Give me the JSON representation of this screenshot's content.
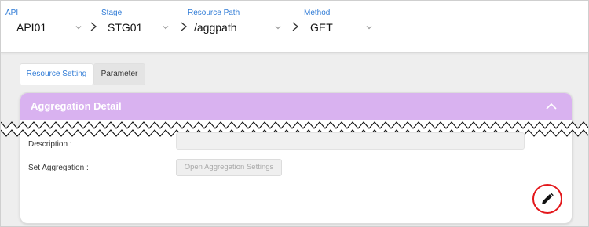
{
  "header": {
    "selectors": [
      {
        "label": "API",
        "value": "API01"
      },
      {
        "label": "Stage",
        "value": "STG01"
      },
      {
        "label": "Resource Path",
        "value": "/aggpath"
      },
      {
        "label": "Method",
        "value": "GET"
      }
    ]
  },
  "tabs": [
    {
      "label": "Resource Setting",
      "active": true
    },
    {
      "label": "Parameter",
      "active": false
    }
  ],
  "panel": {
    "title": "Aggregation Detail",
    "header_color": "#d9b2f0",
    "fields": {
      "description_label": "Description :",
      "description_value": "",
      "set_aggregation_label": "Set Aggregation :",
      "aggregation_button_label": "Open Aggregation Settings"
    }
  },
  "icons": {
    "selector_chevron": "chevron-down-icon",
    "path_separator": "chevron-right-icon",
    "collapse": "chevron-up-icon",
    "edit": "pencil-icon"
  },
  "colors": {
    "label_blue": "#2f7bd6",
    "edit_ring": "#e3171b"
  }
}
